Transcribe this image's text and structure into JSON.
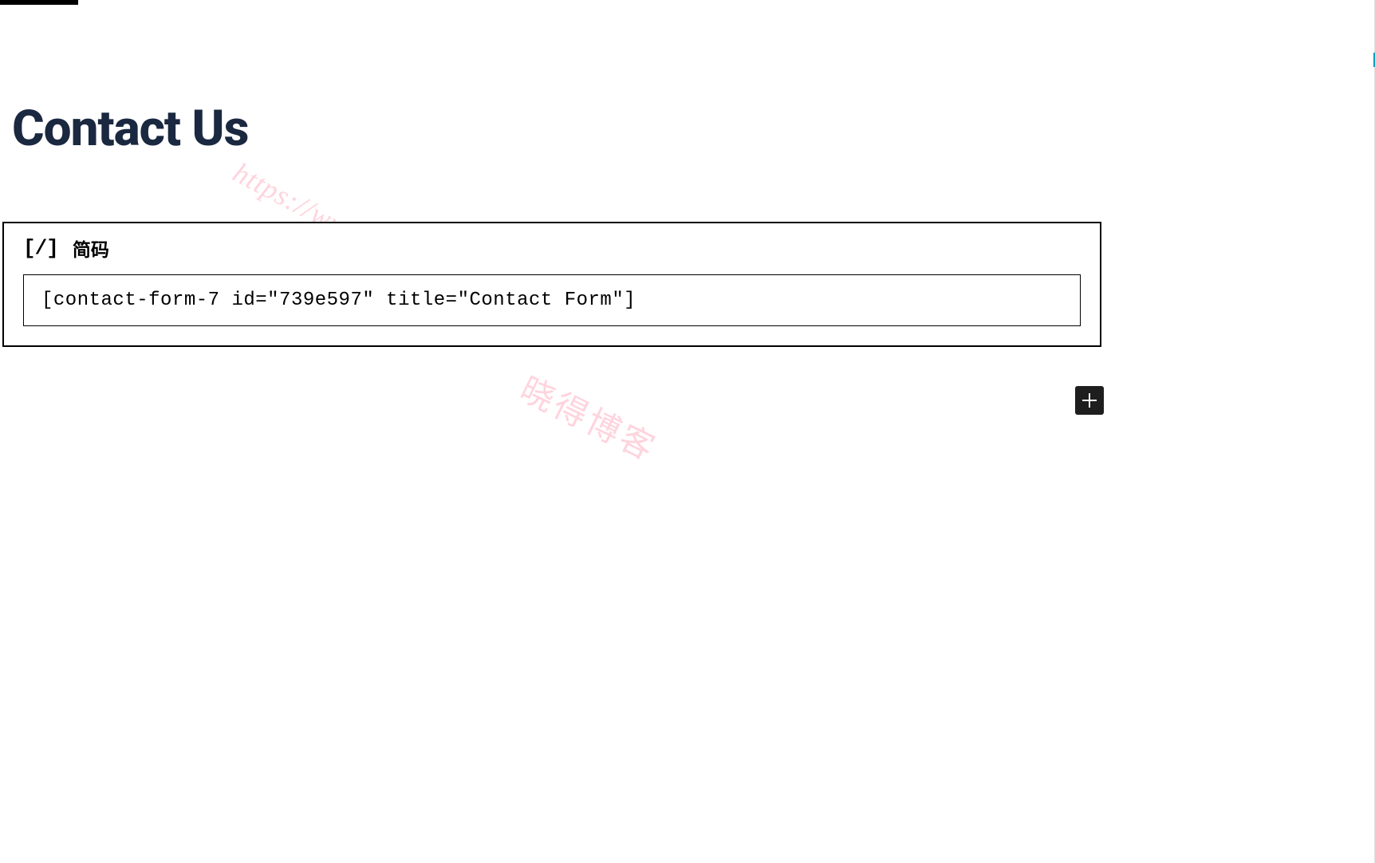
{
  "page": {
    "title": "Contact Us"
  },
  "block": {
    "type_label": "简码",
    "icon_text": "[/]",
    "shortcode_value": "[contact-form-7 id=\"739e597\" title=\"Contact Form\"]"
  },
  "watermark": {
    "url": "https://www.pythonthree.com",
    "name": "晓得博客"
  },
  "controls": {
    "add_block_label": "Add block"
  }
}
